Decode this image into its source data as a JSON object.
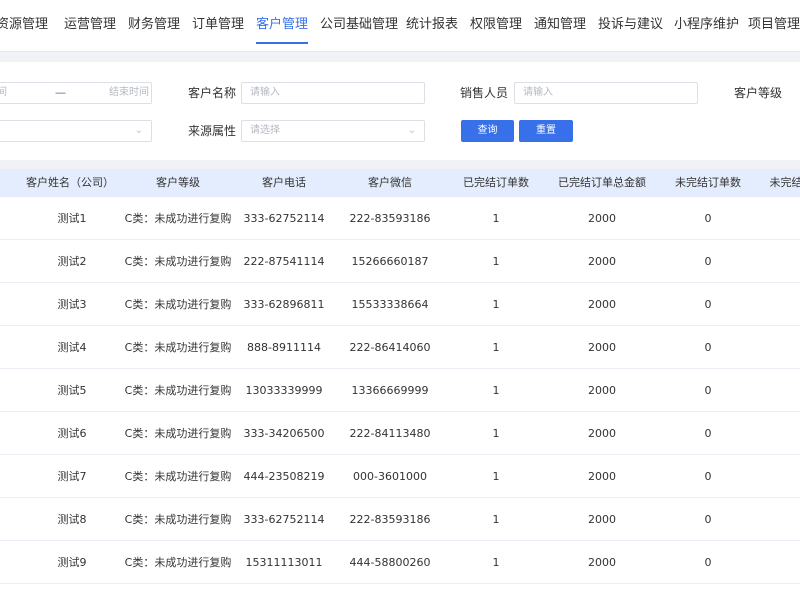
{
  "nav": {
    "items": [
      {
        "label": "资源管理"
      },
      {
        "label": "运营管理"
      },
      {
        "label": "财务管理"
      },
      {
        "label": "订单管理"
      },
      {
        "label": "客户管理"
      },
      {
        "label": "公司基础管理"
      },
      {
        "label": "统计报表"
      },
      {
        "label": "权限管理"
      },
      {
        "label": "通知管理"
      },
      {
        "label": "投诉与建议"
      },
      {
        "label": "小程序维护"
      },
      {
        "label": "项目管理"
      }
    ],
    "active": "客户管理",
    "accent_color": "#3870ea"
  },
  "filters": {
    "date_start_placeholder": "间",
    "date_sep": "—",
    "date_end_placeholder": "结束时间",
    "customer_name_label": "客户名称",
    "customer_name_placeholder": "请输入",
    "sales_label": "销售人员",
    "sales_placeholder": "请输入",
    "level_label": "客户等级",
    "source_label": "来源属性",
    "source_placeholder": "请选择",
    "search_button": "查询",
    "reset_button": "重置"
  },
  "table": {
    "columns": [
      "客户姓名（公司）",
      "客户等级",
      "客户电话",
      "客户微信",
      "已完结订单数",
      "已完结订单总金额",
      "未完结订单数",
      "未完结"
    ],
    "rows": [
      [
        "测试1",
        "C类：未成功进行复购",
        "333-62752114",
        "222-83593186",
        "1",
        "2000",
        "0"
      ],
      [
        "测试2",
        "C类：未成功进行复购",
        "222-87541114",
        "15266660187",
        "1",
        "2000",
        "0"
      ],
      [
        "测试3",
        "C类：未成功进行复购",
        "333-62896811",
        "15533338664",
        "1",
        "2000",
        "0"
      ],
      [
        "测试4",
        "C类：未成功进行复购",
        "888-8911114",
        "222-86414060",
        "1",
        "2000",
        "0"
      ],
      [
        "测试5",
        "C类：未成功进行复购",
        "13033339999",
        "13366669999",
        "1",
        "2000",
        "0"
      ],
      [
        "测试6",
        "C类：未成功进行复购",
        "333-34206500",
        "222-84113480",
        "1",
        "2000",
        "0"
      ],
      [
        "测试7",
        "C类：未成功进行复购",
        "444-23508219",
        "000-3601000",
        "1",
        "2000",
        "0"
      ],
      [
        "测试8",
        "C类：未成功进行复购",
        "333-62752114",
        "222-83593186",
        "1",
        "2000",
        "0"
      ],
      [
        "测试9",
        "C类：未成功进行复购",
        "15311113011",
        "444-58800260",
        "1",
        "2000",
        "0"
      ]
    ]
  }
}
